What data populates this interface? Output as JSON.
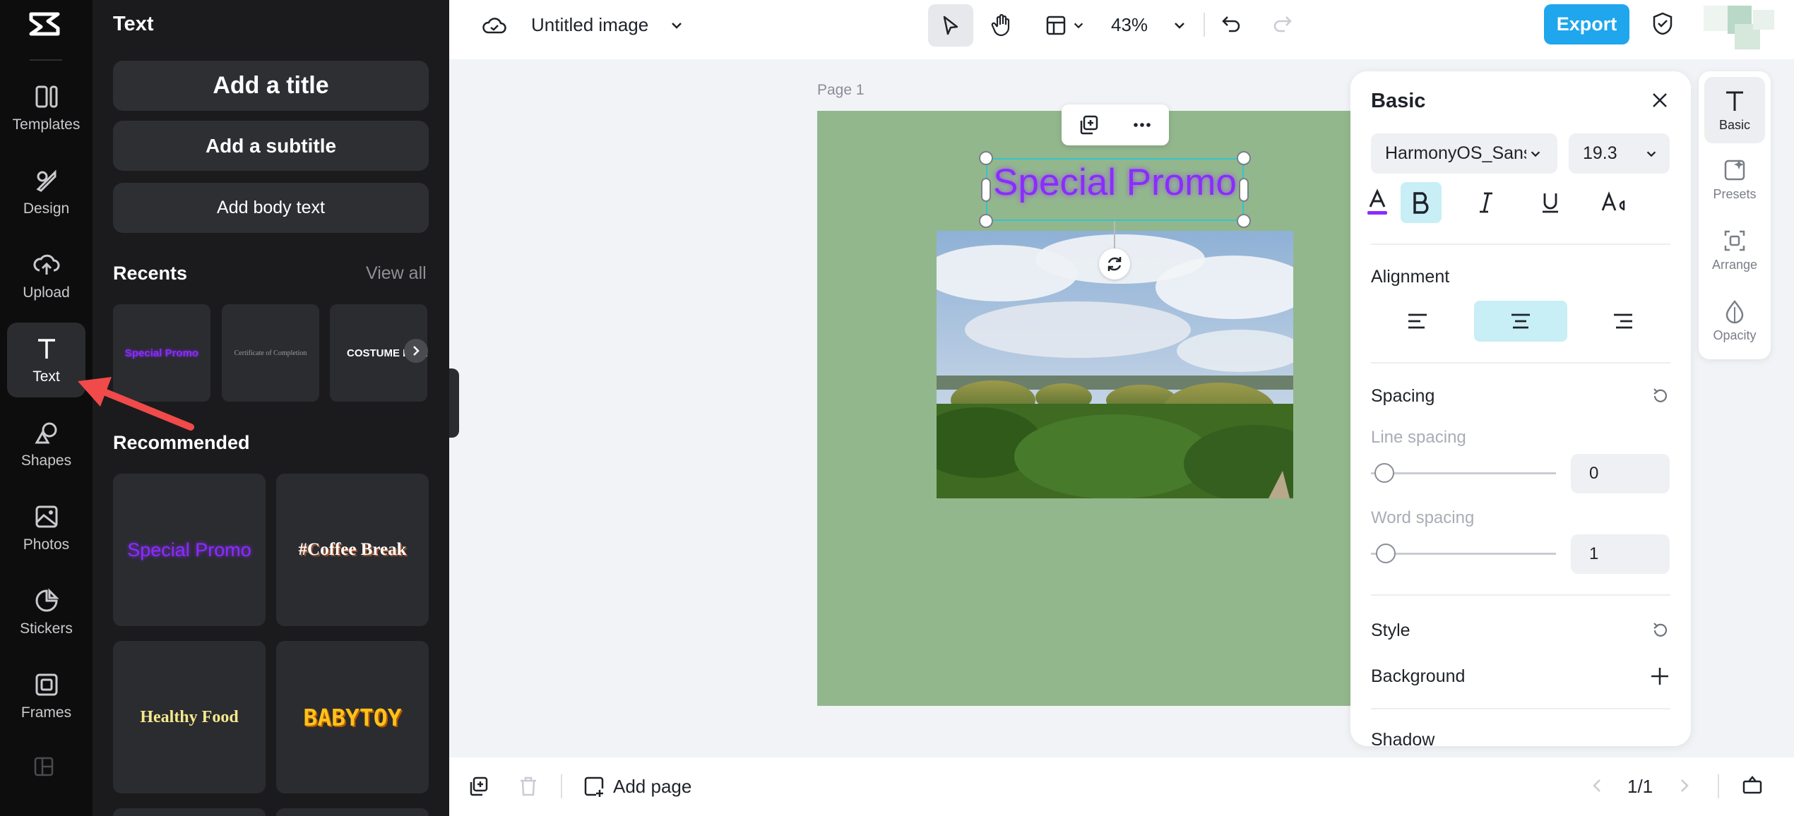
{
  "rail": {
    "items": [
      {
        "label": "Templates",
        "icon": "templates-icon"
      },
      {
        "label": "Design",
        "icon": "design-icon"
      },
      {
        "label": "Upload",
        "icon": "upload-icon"
      },
      {
        "label": "Text",
        "icon": "text-icon",
        "active": true
      },
      {
        "label": "Shapes",
        "icon": "shapes-icon"
      },
      {
        "label": "Photos",
        "icon": "photos-icon"
      },
      {
        "label": "Stickers",
        "icon": "stickers-icon"
      },
      {
        "label": "Frames",
        "icon": "frames-icon"
      }
    ]
  },
  "panel": {
    "title": "Text",
    "add_title": "Add a title",
    "add_subtitle": "Add a subtitle",
    "add_body": "Add body text",
    "recents_title": "Recents",
    "view_all": "View all",
    "recents": [
      "Special Promo",
      "Certificate of Completion",
      "COSTUME PART"
    ],
    "recommended_title": "Recommended",
    "recommended": [
      "Special Promo",
      "#Coffee Break",
      "Healthy Food",
      "BABYTOY"
    ]
  },
  "topbar": {
    "doc_title": "Untitled image",
    "zoom": "43%",
    "export": "Export"
  },
  "canvas": {
    "page_label": "Page 1",
    "selected_text": "Special Promo"
  },
  "bottombar": {
    "add_page": "Add page",
    "page_indicator": "1/1"
  },
  "props": {
    "title": "Basic",
    "font": "HarmonyOS_Sans",
    "size": "19.3",
    "alignment_title": "Alignment",
    "spacing_title": "Spacing",
    "line_spacing_label": "Line spacing",
    "line_spacing_value": "0",
    "word_spacing_label": "Word spacing",
    "word_spacing_value": "1",
    "style_title": "Style",
    "background_label": "Background",
    "shadow_label": "Shadow"
  },
  "rtabs": [
    {
      "label": "Basic",
      "active": true
    },
    {
      "label": "Presets"
    },
    {
      "label": "Arrange"
    },
    {
      "label": "Opacity"
    }
  ],
  "colors": {
    "accent": "#1fa6ec",
    "page_bg": "#93b78d",
    "selected_text": "#8b2cff",
    "selection": "#33c4d0",
    "annotation_arrow": "#f04a4a"
  }
}
